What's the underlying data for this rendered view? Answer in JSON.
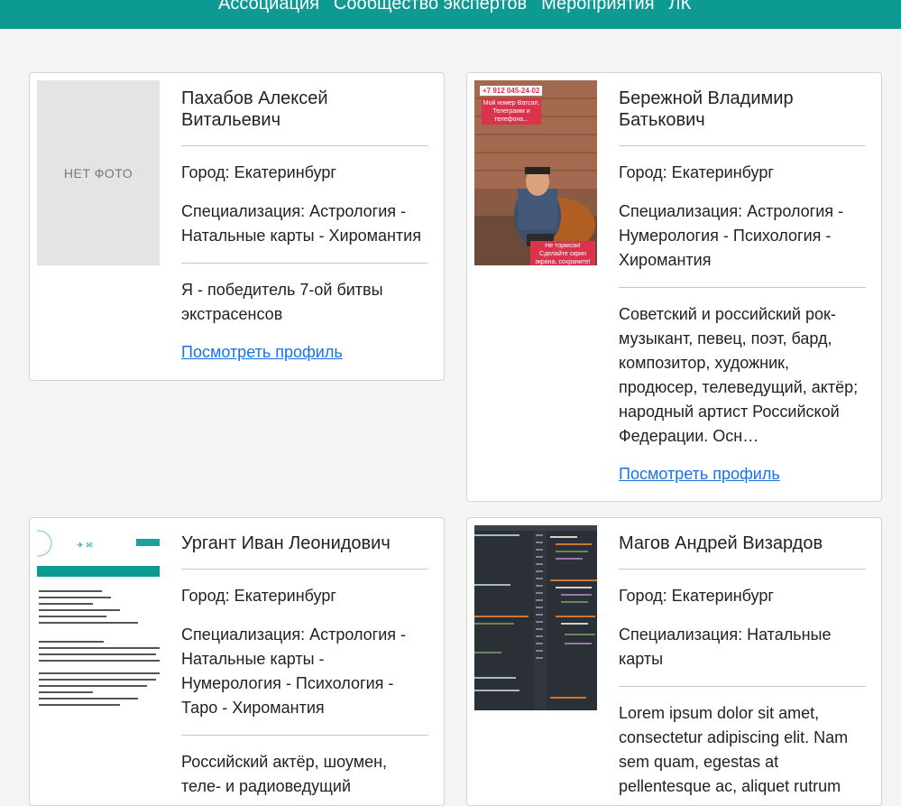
{
  "nav": {
    "items": [
      "Ассоциация",
      "Сообщество экспертов",
      "Мероприятия",
      "ЛК"
    ]
  },
  "cards": [
    {
      "name": "Пахабов Алексей Витальевич",
      "city": "Город: Екатеринбург",
      "spec": "Специализация: Астрология - Натальные карты - Хиромантия",
      "bio": "Я - победитель 7-ой битвы экстрасенсов",
      "link": "Посмотреть профиль",
      "photo_placeholder": "НЕТ ФОТО"
    },
    {
      "name": "Бережной Владимир Батькович",
      "city": "Город: Екатеринбург",
      "spec": "Специализация: Астрология - Нумерология - Психология - Хиромантия",
      "bio": "Советский и российский рок-музыкант, певец, поэт, бард, композитор, художник, продюсер, телеведущий, актёр; народный артист Российской Федерации. Осн…",
      "link": "Посмотреть профиль",
      "photo_caption_top": "+7 912 045-24-02",
      "photo_caption_mid": "Мой номер Ватсап, Телеграмм и телефона...",
      "photo_caption_bottom": "Не тормози! Сделайте скрин экрана, сохраните!"
    },
    {
      "name": "Ургант Иван Леонидович",
      "city": "Город: Екатеринбург",
      "spec": "Специализация: Астрология - Натальные карты - Нумерология - Психология - Таро - Хиромантия",
      "bio": "Российский актёр, шоумен, теле- и радиоведущий"
    },
    {
      "name": "Магов Андрей Визардов",
      "city": "Город: Екатеринбург",
      "spec": "Специализация: Натальные карты",
      "bio": "Lorem ipsum dolor sit amet, consectetur adipiscing elit. Nam sem quam, egestas at pellentesque ac, aliquet rutrum"
    }
  ]
}
